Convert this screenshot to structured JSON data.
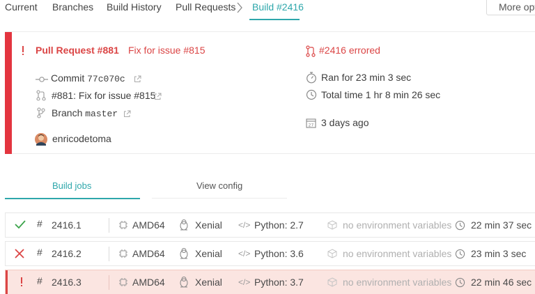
{
  "tabs": {
    "current": "Current",
    "branches": "Branches",
    "build_history": "Build History",
    "pull_requests": "Pull Requests",
    "build": "Build #2416",
    "more_options": "More options"
  },
  "summary": {
    "title_pr": "Pull Request #881",
    "title_msg": "Fix for issue #815",
    "commit_label": "Commit",
    "commit_sha": "77c070c",
    "pr_link": "#881: Fix for issue #815",
    "branch_label": "Branch",
    "branch_name": "master",
    "author": "enricodetoma",
    "build_state": "#2416 errored",
    "ran_for": "Ran for 23 min 3 sec",
    "total_time": "Total time 1 hr 8 min 26 sec",
    "finished": "3 days ago",
    "calendar_day": "27"
  },
  "subtabs": {
    "build_jobs": "Build jobs",
    "view_config": "View config"
  },
  "jobs": [
    {
      "state": "passed",
      "number": "2416.1",
      "arch": "AMD64",
      "dist": "Xenial",
      "lang": "Python: 2.7",
      "env": "no environment variables set",
      "duration": "22 min 37 sec"
    },
    {
      "state": "failed",
      "number": "2416.2",
      "arch": "AMD64",
      "dist": "Xenial",
      "lang": "Python: 3.6",
      "env": "no environment variables set",
      "duration": "23 min 3 sec"
    },
    {
      "state": "errored",
      "number": "2416.3",
      "arch": "AMD64",
      "dist": "Xenial",
      "lang": "Python: 3.7",
      "env": "no environment variables set",
      "duration": "22 min 46 sec"
    }
  ],
  "colors": {
    "accent": "#2ea7ab",
    "error": "#db4545",
    "passed": "#3ba34a",
    "errored_row_bg": "#fbe5e1"
  }
}
